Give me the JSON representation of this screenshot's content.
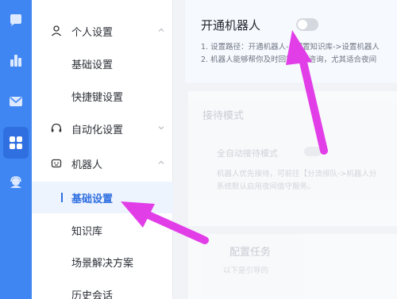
{
  "rail": {
    "icons": [
      "chat-bubble-icon",
      "bar-chart-icon",
      "mail-icon",
      "apps-grid-icon",
      "agent-headset-icon"
    ],
    "active_index": 3,
    "accent": "#3f86f3"
  },
  "sidebar": {
    "groups": [
      {
        "label": "个人设置",
        "icon": "user-icon",
        "expanded": true
      },
      {
        "label": "自动化设置",
        "icon": "headset-icon",
        "expanded": false
      },
      {
        "label": "机器人",
        "icon": "robot-icon",
        "expanded": true
      }
    ],
    "personal_items": [
      "基础设置",
      "快捷键设置"
    ],
    "robot_items": [
      "基础设置",
      "知识库",
      "场景解决方案",
      "历史会话"
    ],
    "active_item": "基础设置"
  },
  "main": {
    "robot_toggle": {
      "label": "开通机器人",
      "on": false
    },
    "notes": [
      "1. 设置路径：开通机器人->配置知识库->设置机器人",
      "2. 机器人能够帮你及时回答买家咨询，尤其适合夜间"
    ],
    "reception": {
      "title": "接待模式",
      "mode_label": "全自动接待模式",
      "desc_lines": [
        "机器人优先接待，可前往【分流排队->机器人分",
        "系统默认启用夜间值守服务。"
      ]
    },
    "config": {
      "title": "配置任务",
      "subtitle": "以下是引导的"
    }
  },
  "annotation": {
    "arrow_color": "#e23ee8"
  }
}
